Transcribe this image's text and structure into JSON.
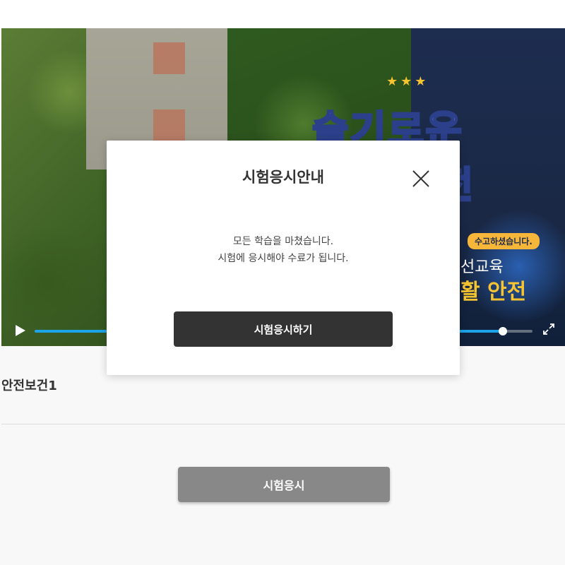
{
  "video": {
    "overlay_title_line1": "슬기로운",
    "overlay_title_line2": "전",
    "promo_badge": "수고하셨습니다.",
    "promo_sub": "선교육",
    "promo_main": "활 안전",
    "progress_fraction": 0.94,
    "accent_color": "#1ca3e8",
    "play_icon": "play-icon",
    "fullscreen_icon": "fullscreen-icon"
  },
  "course": {
    "title": "안전보건1"
  },
  "page": {
    "exam_button_label": "시험응시"
  },
  "modal": {
    "title": "시험응시안내",
    "message_line1": "모든 학습을 마쳤습니다.",
    "message_line2": "시험에 응시해야 수료가 됩니다.",
    "confirm_button_label": "시험응시하기",
    "close_icon": "close-icon"
  }
}
